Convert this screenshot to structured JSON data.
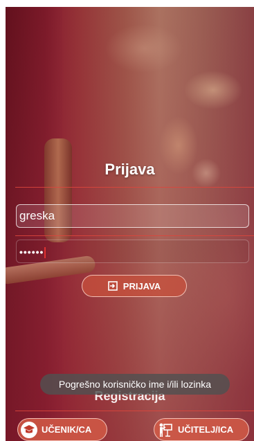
{
  "login": {
    "title": "Prijava",
    "username_value": "greska",
    "password_mask": "••••••",
    "login_button": "PRIJAVA"
  },
  "toast": {
    "message": "Pogrešno korisničko ime i/ili lozinka"
  },
  "registration": {
    "title": "Registracija",
    "student_button": "UČENIK/CA",
    "teacher_button": "UČITELJ/ICA"
  },
  "icons": {
    "login": "login-enter-icon",
    "student": "graduation-cap-icon",
    "teacher": "teacher-board-icon"
  },
  "colors": {
    "accent": "#d25a46",
    "divider": "#dc463c",
    "toast_bg": "#505050"
  }
}
